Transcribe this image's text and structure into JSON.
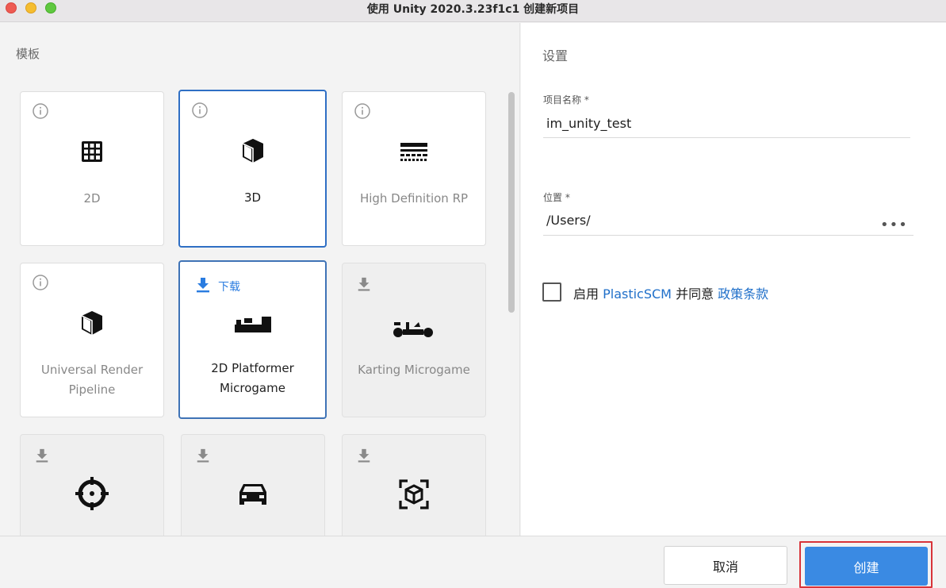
{
  "window": {
    "title": "使用 Unity 2020.3.23f1c1 创建新项目"
  },
  "templates": {
    "section_label": "模板",
    "cards": [
      {
        "name": "2D",
        "corner": "info-icon",
        "icon": "grid-icon",
        "state": "normal"
      },
      {
        "name": "3D",
        "corner": "info-icon",
        "icon": "cube-icon",
        "state": "selected"
      },
      {
        "name": "High Definition RP",
        "corner": "info-icon",
        "icon": "hdrp-icon",
        "state": "normal"
      },
      {
        "name": "Universal Render Pipeline",
        "corner": "info-icon",
        "icon": "cube-icon",
        "state": "normal"
      },
      {
        "name": "2D Platformer Microgame",
        "corner": "download-icon",
        "download_label": "下载",
        "icon": "platformer-icon",
        "state": "hover"
      },
      {
        "name": "Karting Microgame",
        "corner": "download-icon",
        "icon": "karting-icon",
        "state": "disabled"
      },
      {
        "name": "",
        "corner": "download-icon",
        "icon": "crosshair-icon",
        "state": "disabled"
      },
      {
        "name": "",
        "corner": "download-icon",
        "icon": "car-icon",
        "state": "disabled"
      },
      {
        "name": "",
        "corner": "download-icon",
        "icon": "ar-cube-icon",
        "state": "disabled"
      }
    ]
  },
  "settings": {
    "title": "设置",
    "project_name_label": "项目名称 *",
    "project_name_value": "im_unity_test",
    "location_label": "位置 *",
    "location_value": "/Users/",
    "browse_label": "•••",
    "plastic_prefix": "启用 ",
    "plastic_link": "PlasticSCM",
    "plastic_middle": " 并同意 ",
    "policy_link": "政策条款"
  },
  "footer": {
    "cancel_label": "取消",
    "create_label": "创建"
  },
  "colors": {
    "accent": "#3a8ae3",
    "link": "#1f6fc9",
    "selected_border": "#2f6fc4",
    "highlight": "#d8343a"
  }
}
